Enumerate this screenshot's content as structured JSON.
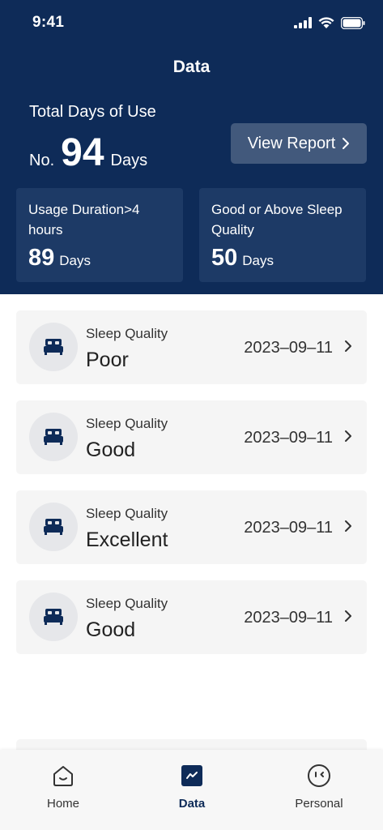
{
  "status_bar": {
    "time": "9:41"
  },
  "header": {
    "title": "Data",
    "total_label": "Total Days of Use",
    "total_prefix": "No.",
    "total_days": "94",
    "total_unit": "Days",
    "view_report_label": "View Report"
  },
  "stats": [
    {
      "label": "Usage Duration>4 hours",
      "value": "89",
      "unit": "Days"
    },
    {
      "label": "Good or Above Sleep Quality",
      "value": "50",
      "unit": "Days"
    }
  ],
  "records": [
    {
      "label": "Sleep Quality",
      "value": "Poor",
      "date": "2023–09–11",
      "icon": "bed-icon"
    },
    {
      "label": "Sleep Quality",
      "value": "Good",
      "date": "2023–09–11",
      "icon": "bed-icon"
    },
    {
      "label": "Sleep Quality",
      "value": "Excellent",
      "date": "2023–09–11",
      "icon": "bed-icon"
    },
    {
      "label": "Sleep Quality",
      "value": "Good",
      "date": "2023–09–11",
      "icon": "bed-icon"
    }
  ],
  "tabs": [
    {
      "label": "Home",
      "icon": "home-icon",
      "active": false
    },
    {
      "label": "Data",
      "icon": "chart-icon",
      "active": true
    },
    {
      "label": "Personal",
      "icon": "face-icon",
      "active": false
    }
  ],
  "colors": {
    "header_bg": "#0e2b58",
    "card_bg": "#1d3a66",
    "accent": "#0e2b58",
    "record_bg": "#f5f5f5"
  }
}
